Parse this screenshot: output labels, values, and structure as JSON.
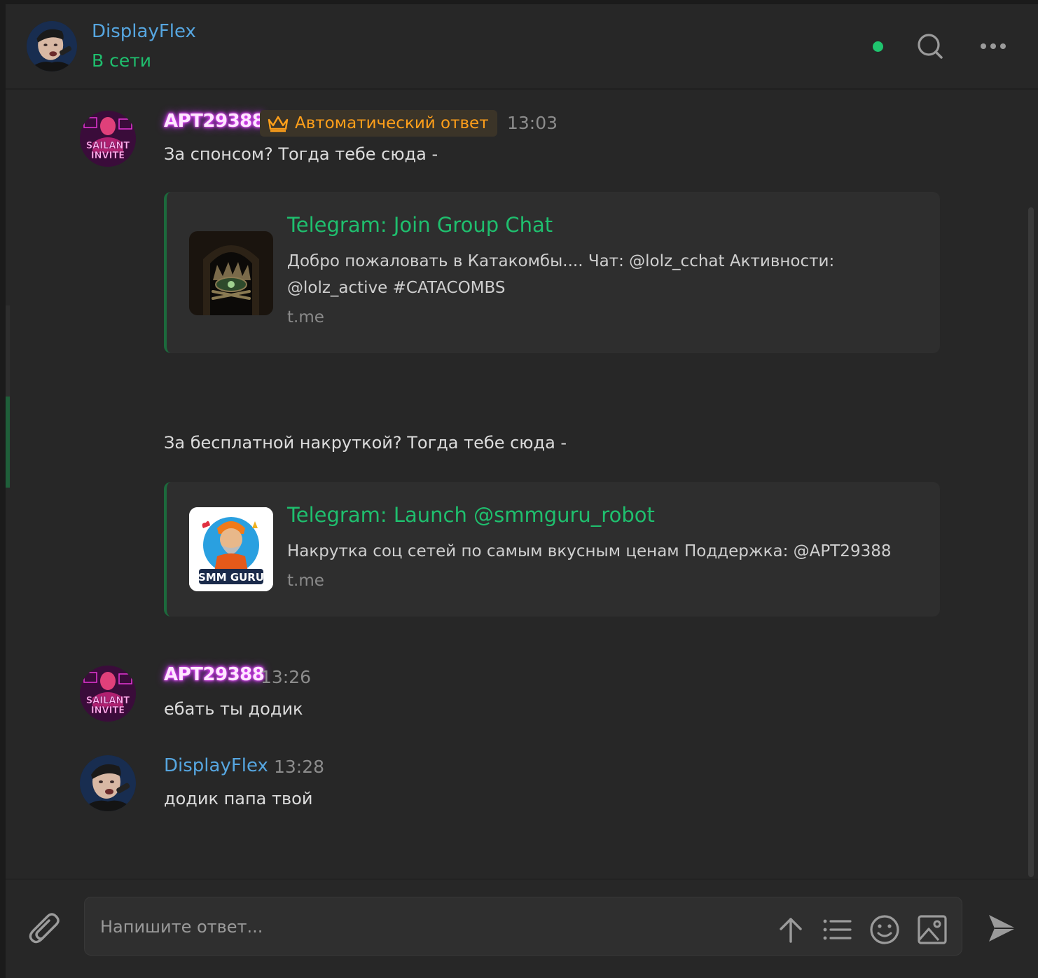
{
  "header": {
    "title": "DisplayFlex",
    "status": "В сети",
    "online_color": "#1fc46e",
    "search_icon": "search-icon",
    "menu_icon": "more-horizontal-icon"
  },
  "messages": [
    {
      "author": "APT29388",
      "badge": "Автоматический ответ",
      "badge_icon": "crown-icon",
      "time": "13:03",
      "text1": "За спонсом? Тогда тебе сюда -",
      "card1": {
        "title": "Telegram: Join Group Chat",
        "description": "Добро пожаловать в Катакомбы.... Чат: @lolz_cchat Активности: @lolz_active #CATACOMBS",
        "domain": "t.me"
      },
      "text2": "За бесплатной накруткой? Тогда тебе сюда -",
      "card2": {
        "title": "Telegram: Launch @smmguru_robot",
        "description": "Накрутка соц сетей по самым вкусным ценам Поддержка: @APT29388",
        "domain": "t.me",
        "image_label": "SMM GURU"
      }
    },
    {
      "author": "APT29388",
      "time": "13:26",
      "text": "ебать ты додик"
    },
    {
      "author": "DisplayFlex",
      "time": "13:28",
      "text": "додик папа твой"
    }
  ],
  "avatar_apt_text": [
    "SAILANT",
    "INVITE"
  ],
  "composer": {
    "placeholder": "Напишите ответ...",
    "attach_icon": "paperclip-icon",
    "tools": [
      "arrow-up-icon",
      "list-icon",
      "emoji-icon",
      "image-icon"
    ],
    "send_icon": "send-icon"
  },
  "colors": {
    "accent_green": "#1fbf6e",
    "link_blue": "#56a6e0",
    "badge_orange": "#ff9f1a",
    "background": "#272727"
  }
}
